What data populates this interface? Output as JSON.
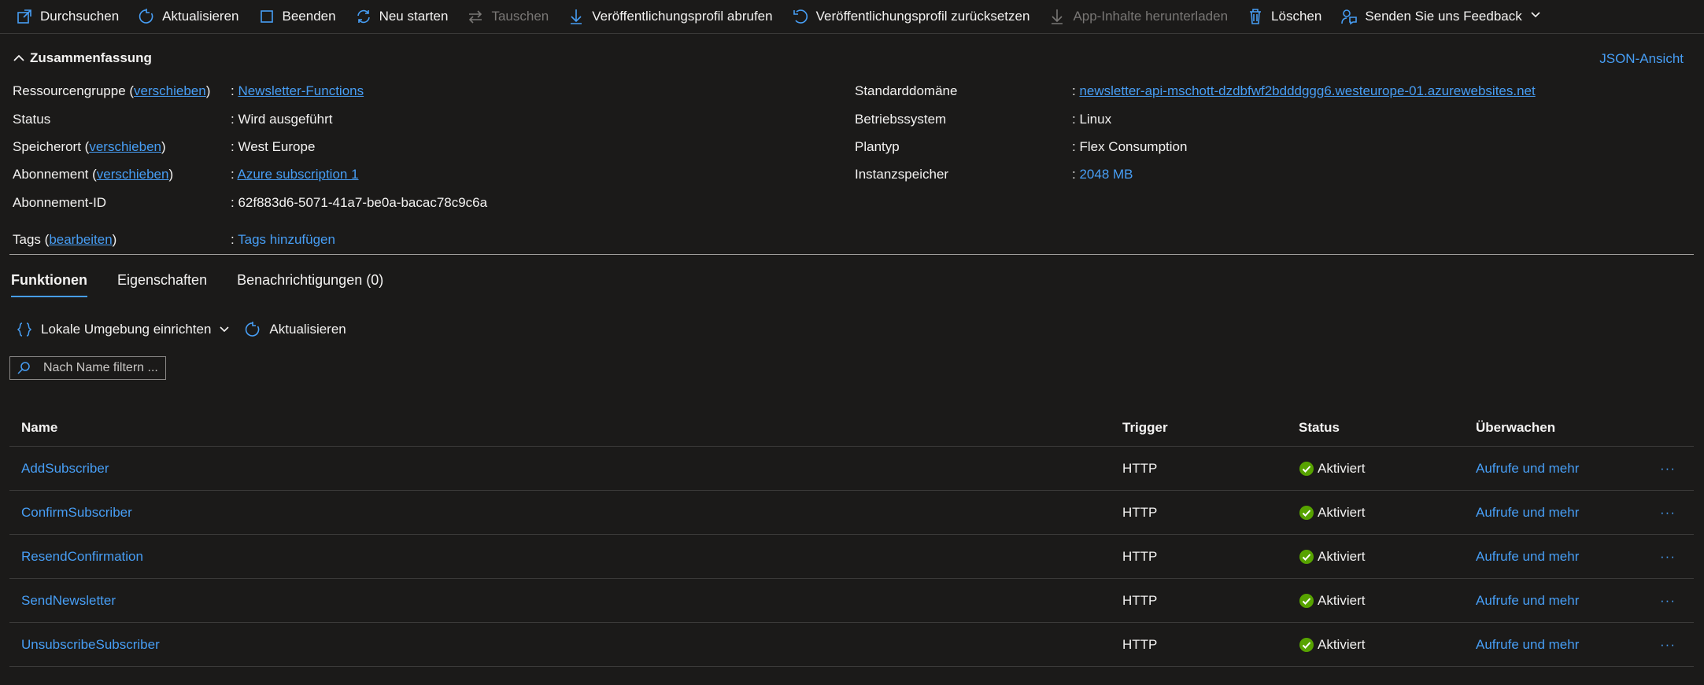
{
  "toolbar": {
    "items": [
      {
        "label": "Durchsuchen"
      },
      {
        "label": "Aktualisieren"
      },
      {
        "label": "Beenden"
      },
      {
        "label": "Neu starten"
      },
      {
        "label": "Tauschen"
      },
      {
        "label": "Veröffentlichungsprofil abrufen"
      },
      {
        "label": "Veröffentlichungsprofil zurücksetzen"
      },
      {
        "label": "App-Inhalte herunterladen"
      },
      {
        "label": "Löschen"
      },
      {
        "label": "Senden Sie uns Feedback"
      }
    ]
  },
  "essentials": {
    "title": "Zusammenfassung",
    "json_view": "JSON-Ansicht",
    "left": {
      "resource_group": {
        "label": "Ressourcengruppe",
        "action": "verschieben",
        "value": "Newsletter-Functions"
      },
      "status": {
        "label": "Status",
        "value": "Wird ausgeführt"
      },
      "location": {
        "label": "Speicherort",
        "action": "verschieben",
        "value": "West Europe"
      },
      "subscription": {
        "label": "Abonnement",
        "action": "verschieben",
        "value": "Azure subscription 1"
      },
      "subscription_id": {
        "label": "Abonnement-ID",
        "value": "62f883d6-5071-41a7-be0a-bacac78c9c6a"
      },
      "tags": {
        "label": "Tags",
        "action": "bearbeiten",
        "value": "Tags hinzufügen"
      }
    },
    "right": {
      "domain": {
        "label": "Standarddomäne",
        "value": "newsletter-api-mschott-dzdbfwf2bdddggg6.westeurope-01.azurewebsites.net"
      },
      "os": {
        "label": "Betriebssystem",
        "value": "Linux"
      },
      "plan": {
        "label": "Plantyp",
        "value": "Flex Consumption"
      },
      "memory": {
        "label": "Instanzspeicher",
        "value": "2048 MB"
      }
    }
  },
  "tabs": [
    {
      "label": "Funktionen"
    },
    {
      "label": "Eigenschaften"
    },
    {
      "label": "Benachrichtigungen (0)"
    }
  ],
  "functions_toolbar": {
    "local_env": "Lokale Umgebung einrichten",
    "refresh": "Aktualisieren"
  },
  "filter": {
    "placeholder": "Nach Name filtern ..."
  },
  "table": {
    "headers": {
      "name": "Name",
      "trigger": "Trigger",
      "status": "Status",
      "monitor": "Überwachen"
    },
    "rows": [
      {
        "name": "AddSubscriber",
        "trigger": "HTTP",
        "status": "Aktiviert",
        "monitor": "Aufrufe und mehr",
        "more": "···"
      },
      {
        "name": "ConfirmSubscriber",
        "trigger": "HTTP",
        "status": "Aktiviert",
        "monitor": "Aufrufe und mehr",
        "more": "···"
      },
      {
        "name": "ResendConfirmation",
        "trigger": "HTTP",
        "status": "Aktiviert",
        "monitor": "Aufrufe und mehr",
        "more": "···"
      },
      {
        "name": "SendNewsletter",
        "trigger": "HTTP",
        "status": "Aktiviert",
        "monitor": "Aufrufe und mehr",
        "more": "···"
      },
      {
        "name": "UnsubscribeSubscriber",
        "trigger": "HTTP",
        "status": "Aktiviert",
        "monitor": "Aufrufe und mehr",
        "more": "···"
      }
    ]
  },
  "colors": {
    "accent": "#479ef5",
    "background": "#1b1a19",
    "success": "#57a300",
    "disabled": "#797775"
  }
}
